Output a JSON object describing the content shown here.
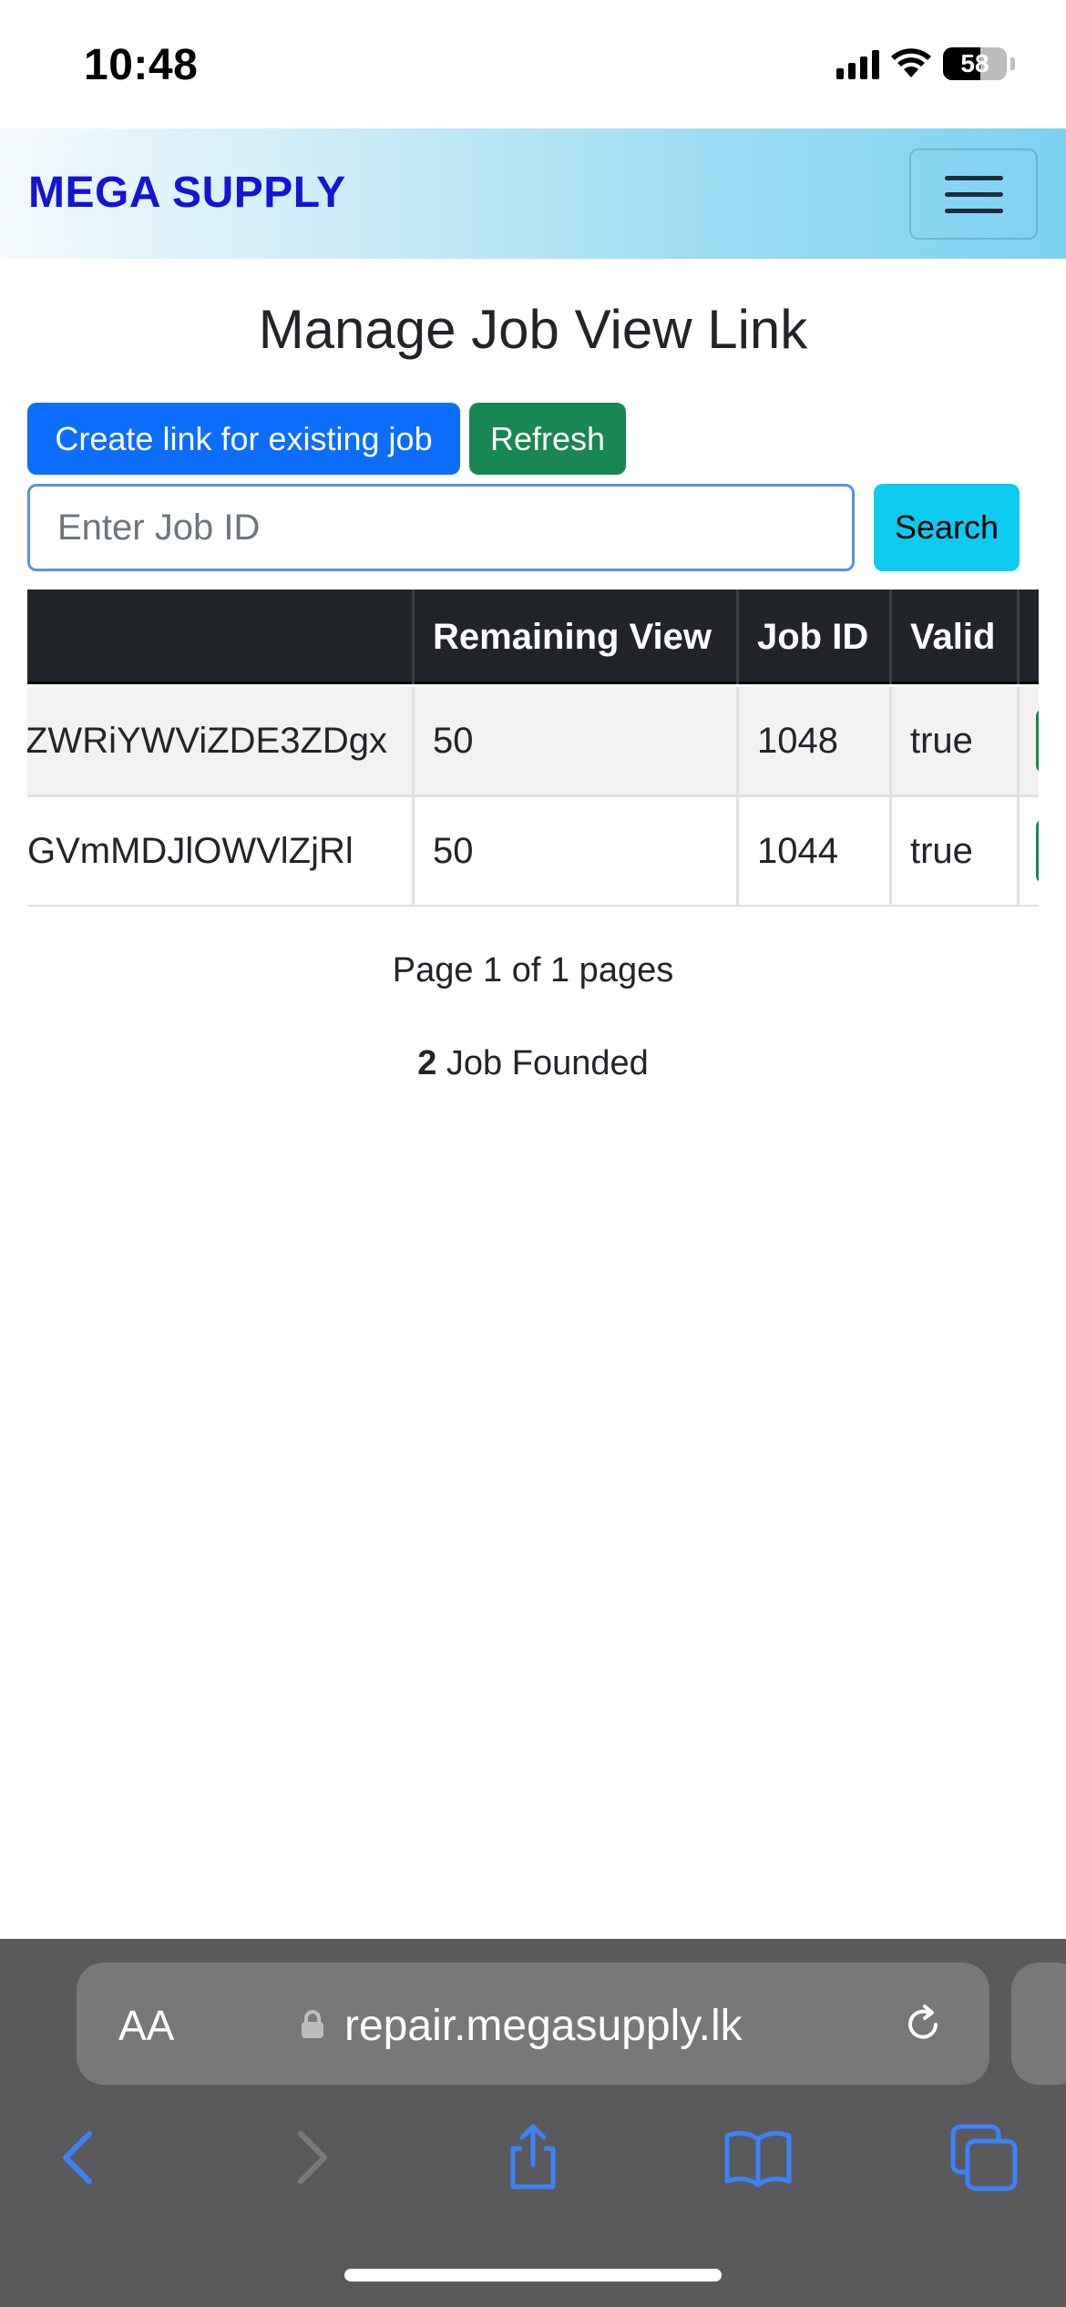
{
  "status_bar": {
    "time": "10:48",
    "battery": "58"
  },
  "navbar": {
    "brand": "MEGA SUPPLY"
  },
  "page": {
    "title": "Manage Job View Link",
    "create_button": "Create link for existing job",
    "refresh_button": "Refresh",
    "search_placeholder": "Enter Job ID",
    "search_value": "",
    "search_button": "Search"
  },
  "table": {
    "headers": [
      "",
      "Remaining View",
      "Job ID",
      "Valid"
    ],
    "rows": [
      {
        "link": "ZWRiYWViZDE3ZDgx",
        "remaining_view": "50",
        "job_id": "1048",
        "valid": "true"
      },
      {
        "link": "GVmMDJlOWVlZjRl",
        "remaining_view": "50",
        "job_id": "1044",
        "valid": "true"
      }
    ]
  },
  "pagination": {
    "text": "Page 1 of 1 pages"
  },
  "found": {
    "count": "2",
    "label": " Job Founded"
  },
  "browser": {
    "aa_label": "AA",
    "url": "repair.megasupply.lk"
  },
  "colors": {
    "primary": "#0d6efd",
    "success": "#198754",
    "info": "#0dcaf0",
    "brand": "#1414d6",
    "table_header": "#212529"
  }
}
